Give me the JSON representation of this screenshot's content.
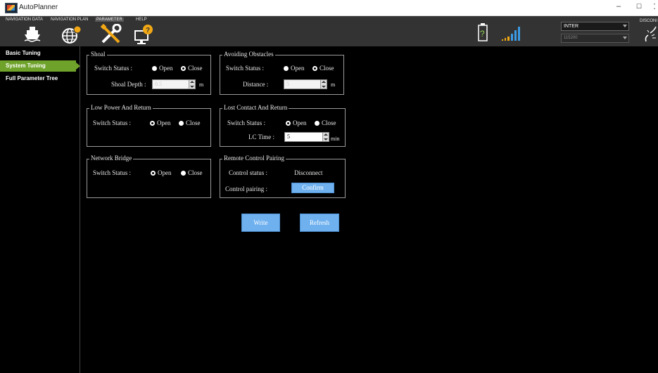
{
  "window": {
    "title": "AutoPlanner",
    "minimize": "–",
    "maximize": "☐"
  },
  "toolbar": {
    "menus": [
      "NAVIGATION DATA",
      "NAVIGATION PLAN",
      "PARAMETER",
      "HELP"
    ],
    "mode_select": "INTER",
    "baud_select": "115200",
    "disconnect_label": "DISCONI"
  },
  "sidebar": {
    "items": [
      {
        "label": "Basic Tuning"
      },
      {
        "label": "System Tuning"
      },
      {
        "label": "Full Parameter Tree"
      }
    ]
  },
  "main": {
    "shoal": {
      "title": "Shoal",
      "switch_label": "Switch Status :",
      "open": "Open",
      "close": "Close",
      "open_checked": true,
      "depth_label": "Shoal Depth :",
      "depth_value": "0.5",
      "unit": "m"
    },
    "avoiding": {
      "title": "Avoiding Obstacles",
      "switch_label": "Switch Status :",
      "open": "Open",
      "close": "Close",
      "open_checked": true,
      "distance_label": "Distance :",
      "distance_value": "5",
      "unit": "m"
    },
    "low_power": {
      "title": "Low Power And Return",
      "switch_label": "Switch Status :",
      "open": "Open",
      "close": "Close",
      "open_checked": false
    },
    "lost_contact": {
      "title": "Lost Contact And Return",
      "switch_label": "Switch Status :",
      "open": "Open",
      "close": "Close",
      "open_checked": false,
      "lc_label": "LC Time :",
      "lc_value": "5",
      "unit": "min"
    },
    "network_bridge": {
      "title": "Network Bridge",
      "switch_label": "Switch Status :",
      "open": "Open",
      "close": "Close",
      "open_checked": false
    },
    "remote_pairing": {
      "title": "Remote Control Pairing",
      "status_label": "Control status :",
      "status_value": "Disconnect",
      "pairing_label": "Control pairing :",
      "confirm_label": "Confirm"
    },
    "write_label": "Write",
    "refresh_label": "Refresh"
  },
  "colors": {
    "accent_green": "#6ea22a",
    "button_blue": "#6fb1ef",
    "toolbar_bg": "#333333"
  }
}
